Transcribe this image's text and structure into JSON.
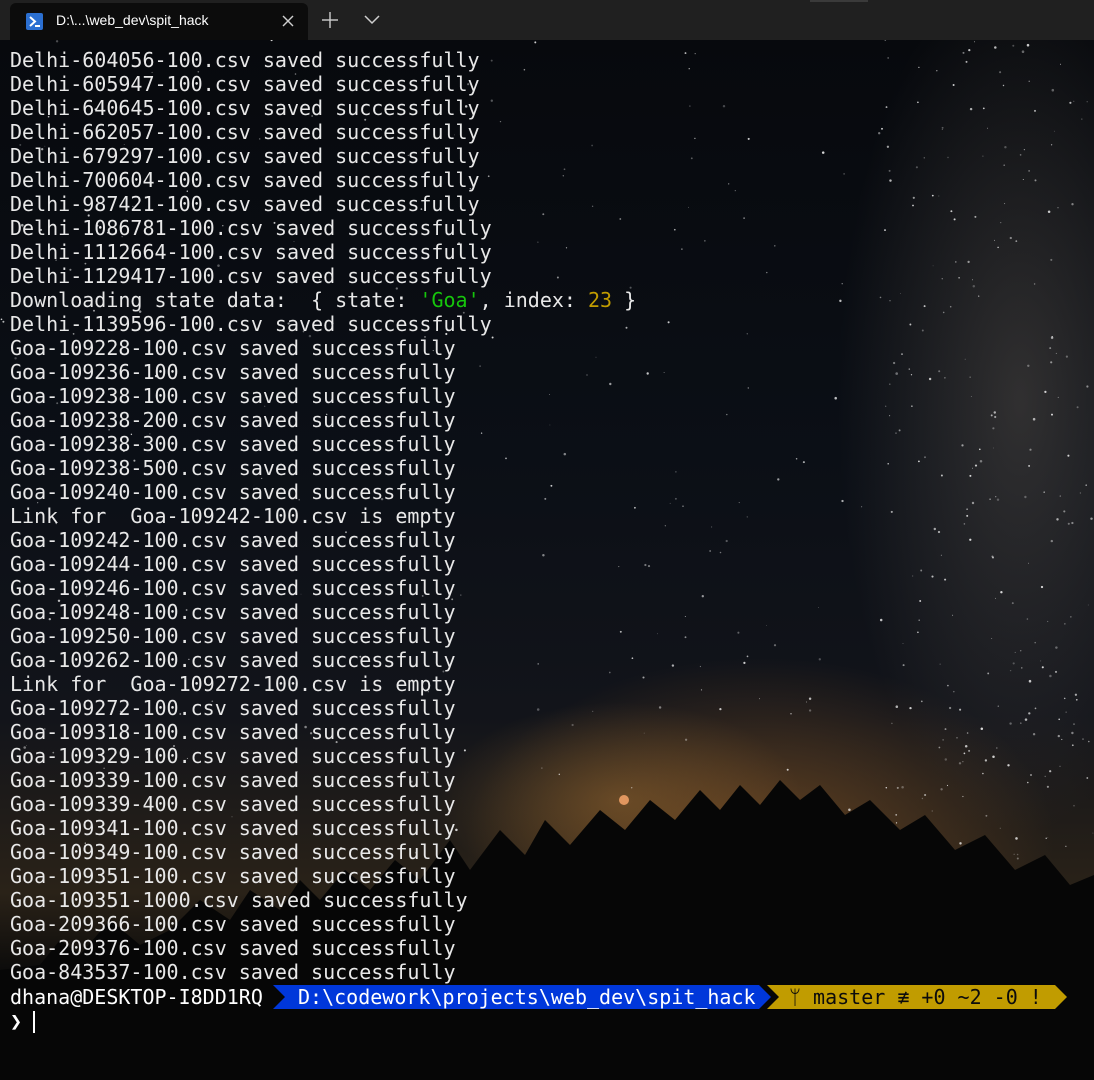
{
  "tab": {
    "title": "D:\\...\\web_dev\\spit_hack",
    "icon": "powershell-icon"
  },
  "colors": {
    "string": "#16c60c",
    "number": "#c19c00",
    "path_segment": "#0037da",
    "git_segment": "#c19c00"
  },
  "output": [
    "Delhi-604056-100.csv saved successfully",
    "Delhi-605947-100.csv saved successfully",
    "Delhi-640645-100.csv saved successfully",
    "Delhi-662057-100.csv saved successfully",
    "Delhi-679297-100.csv saved successfully",
    "Delhi-700604-100.csv saved successfully",
    "Delhi-987421-100.csv saved successfully",
    "Delhi-1086781-100.csv saved successfully",
    "Delhi-1112664-100.csv saved successfully",
    "Delhi-1129417-100.csv saved successfully",
    "Delhi-1139596-100.csv saved successfully",
    "Goa-109228-100.csv saved successfully",
    "Goa-109236-100.csv saved successfully",
    "Goa-109238-100.csv saved successfully",
    "Goa-109238-200.csv saved successfully",
    "Goa-109238-300.csv saved successfully",
    "Goa-109238-500.csv saved successfully",
    "Goa-109240-100.csv saved successfully",
    "Link for  Goa-109242-100.csv is empty",
    "Goa-109242-100.csv saved successfully",
    "Goa-109244-100.csv saved successfully",
    "Goa-109246-100.csv saved successfully",
    "Goa-109248-100.csv saved successfully",
    "Goa-109250-100.csv saved successfully",
    "Goa-109262-100.csv saved successfully",
    "Link for  Goa-109272-100.csv is empty",
    "Goa-109272-100.csv saved successfully",
    "Goa-109318-100.csv saved successfully",
    "Goa-109329-100.csv saved successfully",
    "Goa-109339-100.csv saved successfully",
    "Goa-109339-400.csv saved successfully",
    "Goa-109341-100.csv saved successfully",
    "Goa-109349-100.csv saved successfully",
    "Goa-109351-100.csv saved successfully",
    "Goa-109351-1000.csv saved successfully",
    "Goa-209366-100.csv saved successfully",
    "Goa-209376-100.csv saved successfully",
    "Goa-843537-100.csv saved successfully"
  ],
  "state_log": {
    "prefix": "Downloading state data:  { state: ",
    "state_value": "'Goa'",
    "middle": ", index: ",
    "index_value": "23",
    "suffix": " }"
  },
  "prompt": {
    "user_host": "dhana@DESKTOP-I8DD1RQ",
    "path": "D:\\codework\\projects\\web_dev\\spit_hack",
    "git_status": "ᛘ master ≢ +0 ~2 -0 !",
    "chevron": "❯"
  }
}
